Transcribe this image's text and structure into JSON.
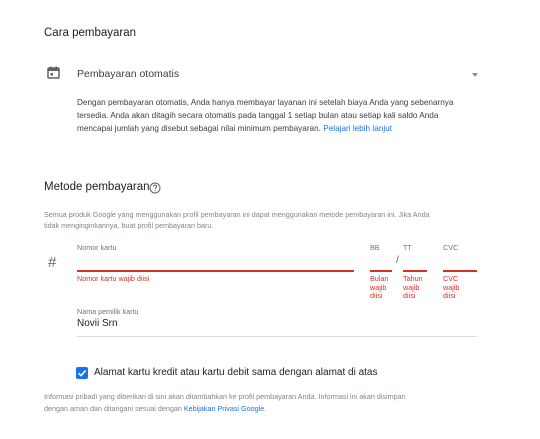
{
  "payment_method_section": {
    "title": "Cara pembayaran",
    "dropdown": {
      "icon": "calendar-icon",
      "selected": "Pembayaran otomatis"
    },
    "description_lines": [
      "Dengan pembayaran otomatis, Anda hanya membayar layanan ini setelah biaya Anda yang sebenarnya",
      "tersedia. Anda akan ditagih secara otomatis pada tanggal 1 setiap bulan atau setiap kali saldo Anda"
    ],
    "description_last": "mencapai jumlah yang disebut sebagai nilai minimum pembayaran.",
    "learn_more_link": "Pelajari lebih lanjut"
  },
  "card_section": {
    "title": "Metode pembayaran",
    "help_icon": "help-circle-icon",
    "note_lines": [
      "Semua produk Google yang menggunakan profil pembayaran ini dapat menggunakan metode pembayaran ini. Jika Anda",
      "tidak menginginkannya, buat profil pembayaran baru."
    ],
    "card_icon": "#",
    "card_number": {
      "label": "Nomor kartu",
      "value": "",
      "error": "Nomor kartu wajib diisi"
    },
    "month": {
      "label": "BB",
      "error_lines": [
        "Bulan",
        "wajib",
        "diisi"
      ]
    },
    "separator": "/",
    "year": {
      "label": "TT",
      "error_lines": [
        "Tahun",
        "wajib",
        "diisi"
      ]
    },
    "cvc": {
      "label": "CVC",
      "error_lines": [
        "CVC",
        "wajib",
        "diisi"
      ]
    },
    "cardholder": {
      "label": "Nama pemilik kartu",
      "value": "Novii Srn"
    },
    "same_address_checkbox": {
      "checked": true,
      "label": "Alamat kartu kredit atau kartu debit sama dengan alamat di atas"
    },
    "privacy_lines": [
      "Informasi pribadi yang diberikan di sini akan ditambahkan ke profil pembayaran Anda. Informasi ini akan disimpan"
    ],
    "privacy_last": "dengan aman dan ditangani sesuai dengan",
    "privacy_link": "Kebijakan Privasi Google",
    "privacy_end": "."
  },
  "colors": {
    "accent": "#1a73e8",
    "error": "#d93025",
    "text": "#3c4043"
  }
}
